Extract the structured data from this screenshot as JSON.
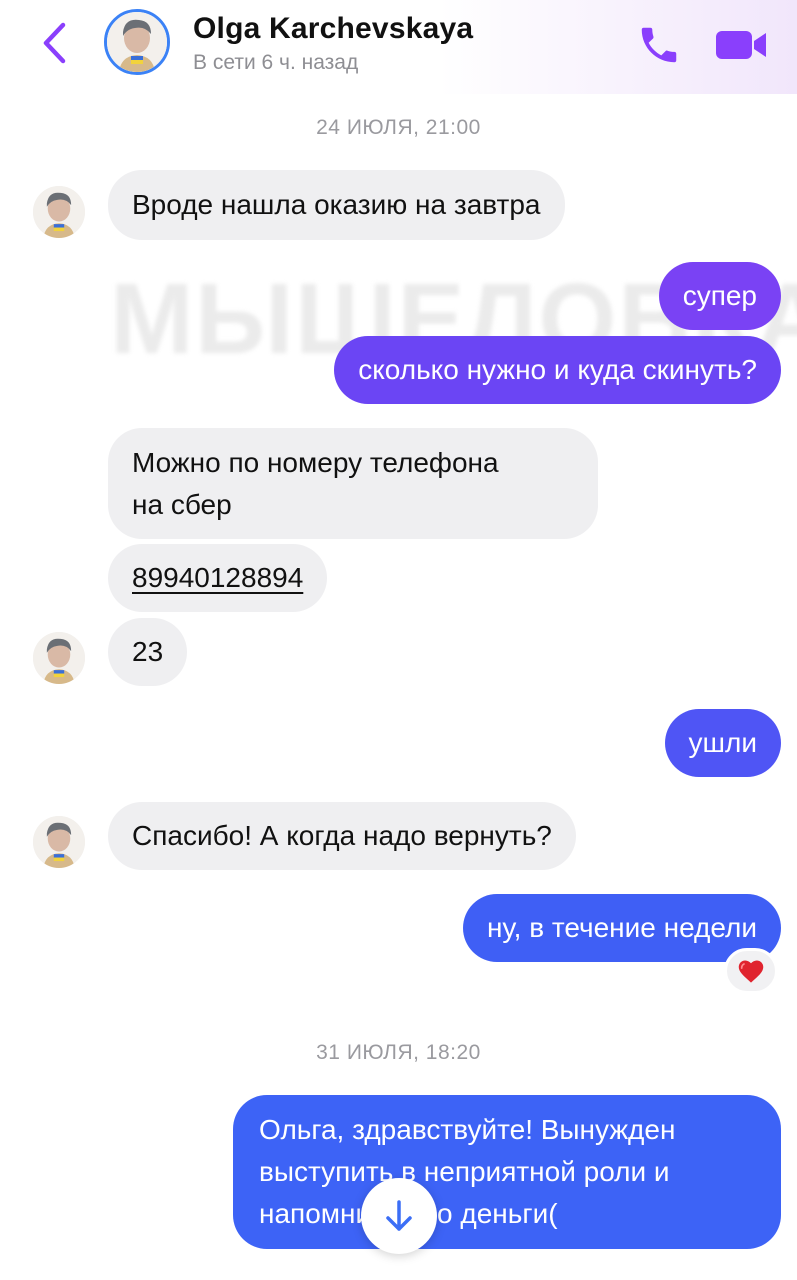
{
  "header": {
    "name": "Olga Karchevskaya",
    "status": "В сети 6 ч. назад"
  },
  "watermark": "МЫШЕЛОВКА",
  "dates": [
    "24 ИЮЛЯ, 21:00",
    "31 ИЮЛЯ, 18:20"
  ],
  "messages": [
    {
      "dir": "in",
      "text": "Вроде нашла оказию на завтра"
    },
    {
      "dir": "out",
      "text": "супер"
    },
    {
      "dir": "out",
      "text": "сколько нужно и куда скинуть?"
    },
    {
      "dir": "in",
      "line1": "Можно по номеру телефона",
      "line2": "на сбер"
    },
    {
      "dir": "in",
      "text": "89940128894"
    },
    {
      "dir": "in",
      "text": "23"
    },
    {
      "dir": "out",
      "text": "ушли"
    },
    {
      "dir": "in",
      "text": "Спасибо! А когда надо вернуть?"
    },
    {
      "dir": "out",
      "text": "ну, в течение недели",
      "reaction": "heart"
    },
    {
      "dir": "out",
      "line1": "Ольга, здравствуйте! Вынужден",
      "line2": "выступить в неприятной роли и",
      "line3": "напомнить про деньги("
    }
  ],
  "colors": {
    "accent": "#8a3ffc",
    "out_purple": "#7a42f4",
    "out_blue": "#3f5ff5",
    "in_bg": "#efeff1"
  },
  "icons": {
    "back": "chevron-left-icon",
    "call": "phone-icon",
    "video": "video-camera-icon",
    "scroll": "arrow-down-icon",
    "reaction": "heart-icon"
  }
}
